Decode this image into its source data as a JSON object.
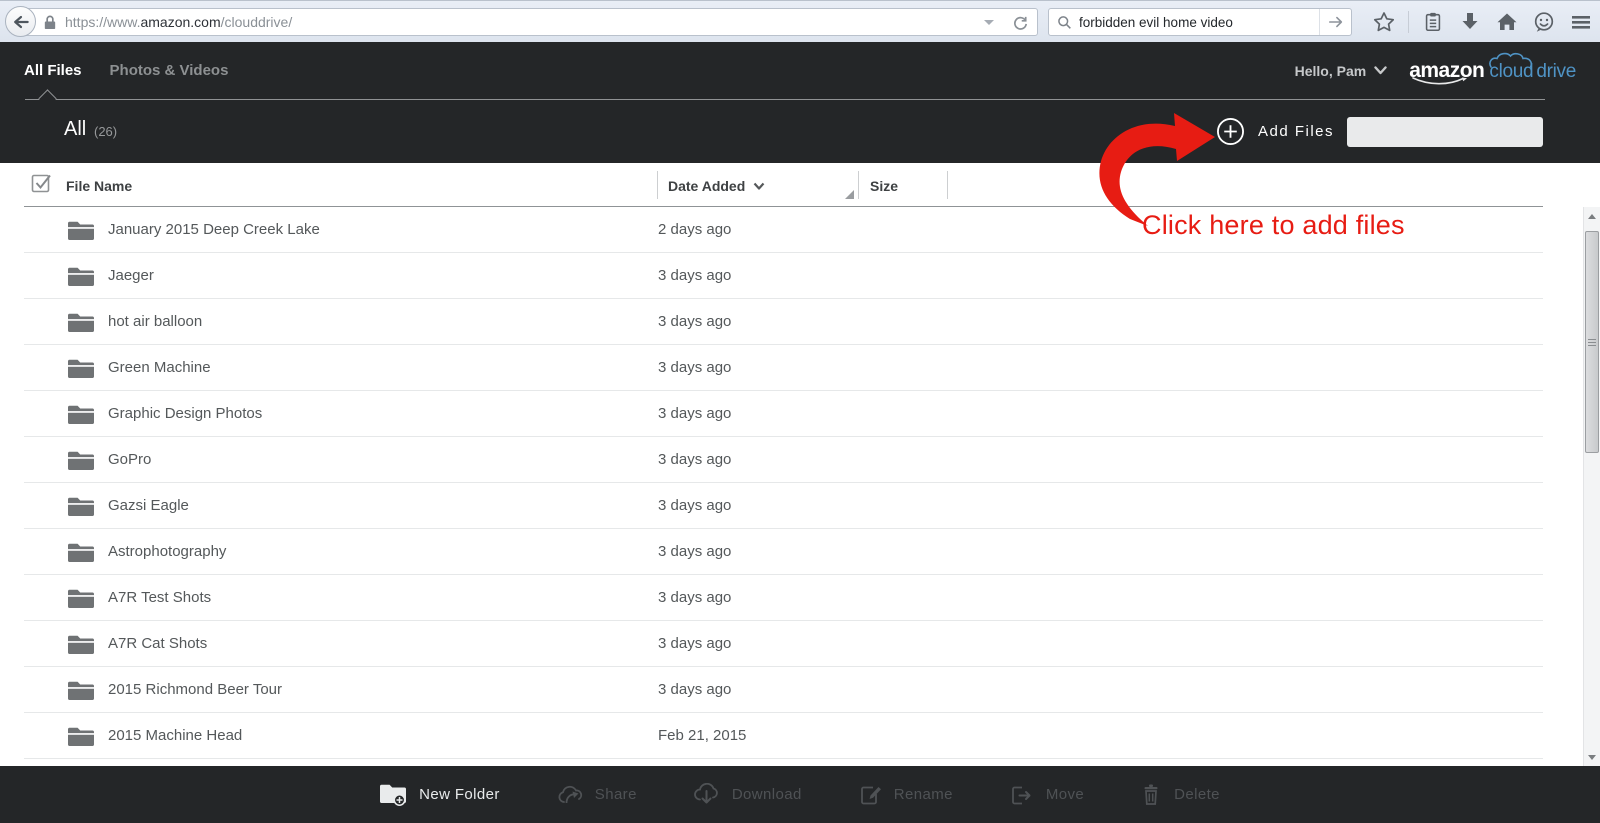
{
  "browser": {
    "url": {
      "prefix": "https://www.",
      "domain": "amazon.com",
      "path": "/clouddrive/"
    },
    "search": {
      "value": "forbidden evil home video"
    },
    "icons": [
      "back-icon",
      "lock-icon",
      "url-dropdown-icon",
      "reload-icon",
      "search-icon",
      "go-arrow-icon",
      "star-icon",
      "bookmarks-icon",
      "downloads-icon",
      "home-icon",
      "hello-smiley-icon",
      "menu-icon"
    ]
  },
  "nav": {
    "tabs": [
      {
        "label": "All Files",
        "active": true
      },
      {
        "label": "Photos & Videos",
        "active": false
      }
    ],
    "greeting": "Hello, Pam",
    "logo": {
      "amazon": "amazon",
      "cloud": "cloud",
      "drive": "drive"
    }
  },
  "toolbar": {
    "view_label": "All",
    "count": "(26)",
    "add_files_label": "Add Files",
    "search_value": ""
  },
  "annotation": {
    "text": "Click here to add files",
    "color": "#e71c13"
  },
  "table": {
    "columns": {
      "file_name": "File Name",
      "date_added": "Date Added",
      "size": "Size"
    },
    "rows": [
      {
        "name": "January 2015 Deep Creek Lake",
        "date": "2 days ago"
      },
      {
        "name": "Jaeger",
        "date": "3 days ago"
      },
      {
        "name": "hot air balloon",
        "date": "3 days ago"
      },
      {
        "name": "Green Machine",
        "date": "3 days ago"
      },
      {
        "name": "Graphic Design Photos",
        "date": "3 days ago"
      },
      {
        "name": "GoPro",
        "date": "3 days ago"
      },
      {
        "name": "Gazsi Eagle",
        "date": "3 days ago"
      },
      {
        "name": "Astrophotography",
        "date": "3 days ago"
      },
      {
        "name": "A7R Test Shots",
        "date": "3 days ago"
      },
      {
        "name": "A7R Cat Shots",
        "date": "3 days ago"
      },
      {
        "name": "2015 Richmond Beer Tour",
        "date": "3 days ago"
      },
      {
        "name": "2015 Machine Head",
        "date": "Feb 21, 2015"
      }
    ]
  },
  "footer": {
    "items": [
      {
        "label": "New Folder",
        "disabled": false
      },
      {
        "label": "Share",
        "disabled": true
      },
      {
        "label": "Download",
        "disabled": true
      },
      {
        "label": "Rename",
        "disabled": true
      },
      {
        "label": "Move",
        "disabled": true
      },
      {
        "label": "Delete",
        "disabled": true
      }
    ]
  },
  "colors": {
    "accent_red": "#e71c13",
    "logo_blue": "#4f93c5",
    "header_bg": "#242628"
  }
}
